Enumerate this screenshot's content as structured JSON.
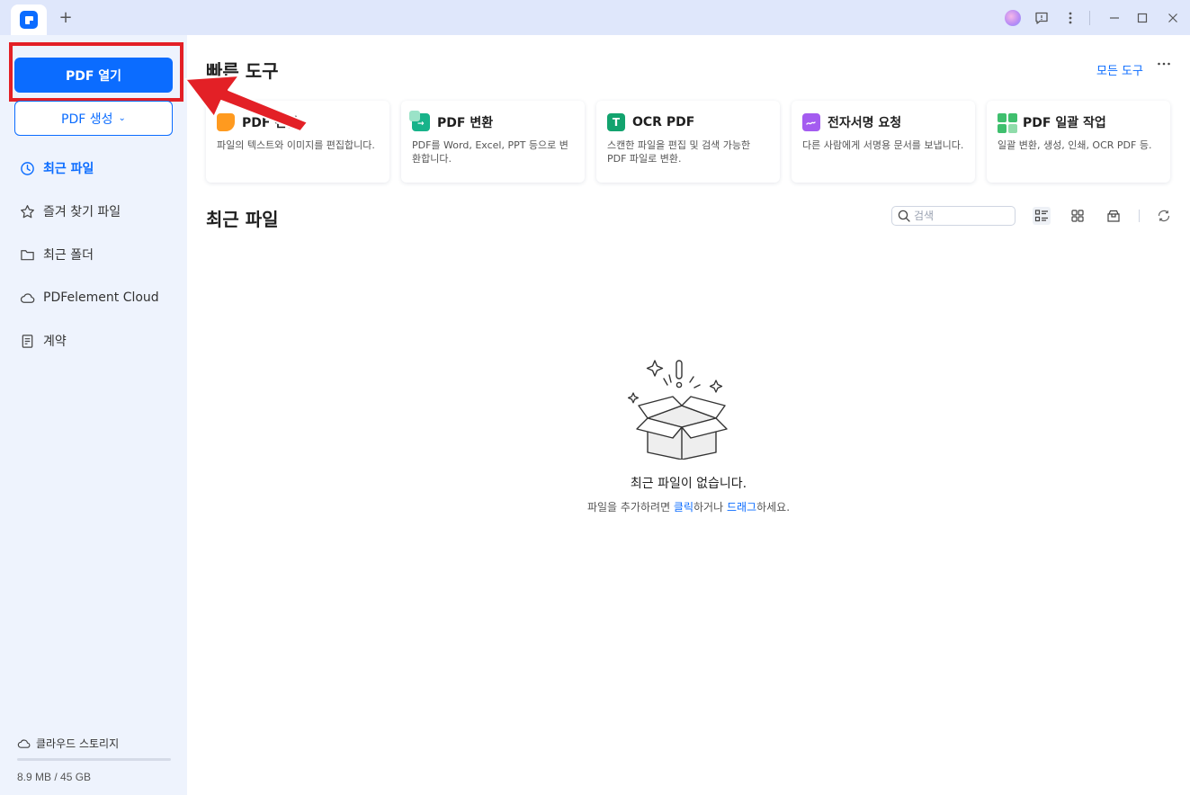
{
  "titlebar": {
    "new_tab_label": "+"
  },
  "sidebar": {
    "open_pdf_label": "PDF 열기",
    "create_pdf_label": "PDF 생성",
    "items": [
      {
        "label": "최근 파일",
        "icon": "clock-icon",
        "active": true
      },
      {
        "label": "즐겨 찾기 파일",
        "icon": "star-icon",
        "active": false
      },
      {
        "label": "최근 폴더",
        "icon": "folder-icon",
        "active": false
      },
      {
        "label": "PDFelement Cloud",
        "icon": "cloud-icon",
        "active": false
      },
      {
        "label": "계약",
        "icon": "document-icon",
        "active": false
      }
    ],
    "storage": {
      "label": "클라우드 스토리지",
      "size": "8.9 MB / 45 GB",
      "used_fraction": 0.0002
    }
  },
  "quick_tools": {
    "title": "빠른 도구",
    "all_tools_label": "모든 도구",
    "cards": [
      {
        "title": "PDF 편집",
        "desc": "파일의 텍스트와 이미지를 편집합니다.",
        "color": "#ff9a1f"
      },
      {
        "title": "PDF 변환",
        "desc": "PDF를 Word, Excel, PPT 등으로 변환합니다.",
        "color": "#18b38a"
      },
      {
        "title": "OCR PDF",
        "desc": "스캔한 파일을 편집 및 검색 가능한 PDF 파일로 변환.",
        "color": "#12a36e"
      },
      {
        "title": "전자서명 요청",
        "desc": "다른 사람에게 서명용 문서를 보냅니다.",
        "color": "#a45cf0"
      },
      {
        "title": "PDF 일괄 작업",
        "desc": "일괄 변환, 생성, 인쇄, OCR PDF 등.",
        "color": "#3fbf6e"
      }
    ]
  },
  "recent": {
    "title": "최근 파일",
    "search_placeholder": "검색",
    "empty_title": "최근 파일이 없습니다.",
    "empty_hint_prefix": "파일을 추가하려면 ",
    "empty_hint_click": "클릭",
    "empty_hint_mid": "하거나 ",
    "empty_hint_drag": "드래그",
    "empty_hint_suffix": "하세요."
  },
  "colors": {
    "accent": "#0b6cff",
    "annotation_red": "#e32026",
    "sidebar_bg": "#eef3fd",
    "titlebar_bg": "#dfe7fb"
  }
}
